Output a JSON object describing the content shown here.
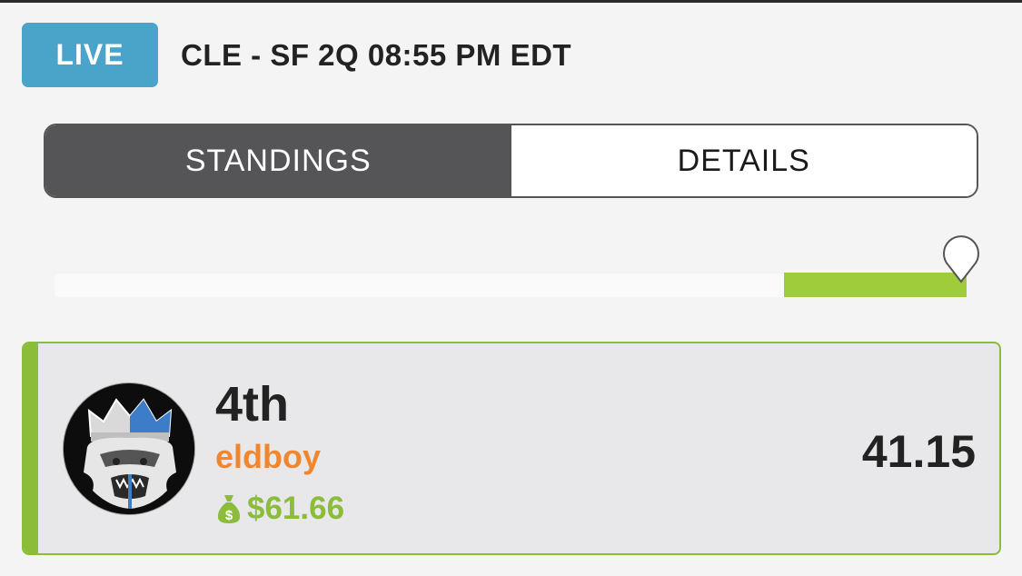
{
  "header": {
    "live_label": "LIVE",
    "game_info": "CLE - SF 2Q 08:55 PM EDT"
  },
  "tabs": [
    {
      "label": "STANDINGS",
      "active": true
    },
    {
      "label": "DETAILS",
      "active": false
    }
  ],
  "progress": {
    "fill_fraction": 0.2,
    "color": "#9ecc3b"
  },
  "entry": {
    "rank": "4th",
    "username": "eldboy",
    "winnings": "$61.66",
    "score": "41.15",
    "avatar_icon": "gorilla-king-avatar",
    "accent_color": "#8bbd3a",
    "username_color": "#f0872f"
  }
}
